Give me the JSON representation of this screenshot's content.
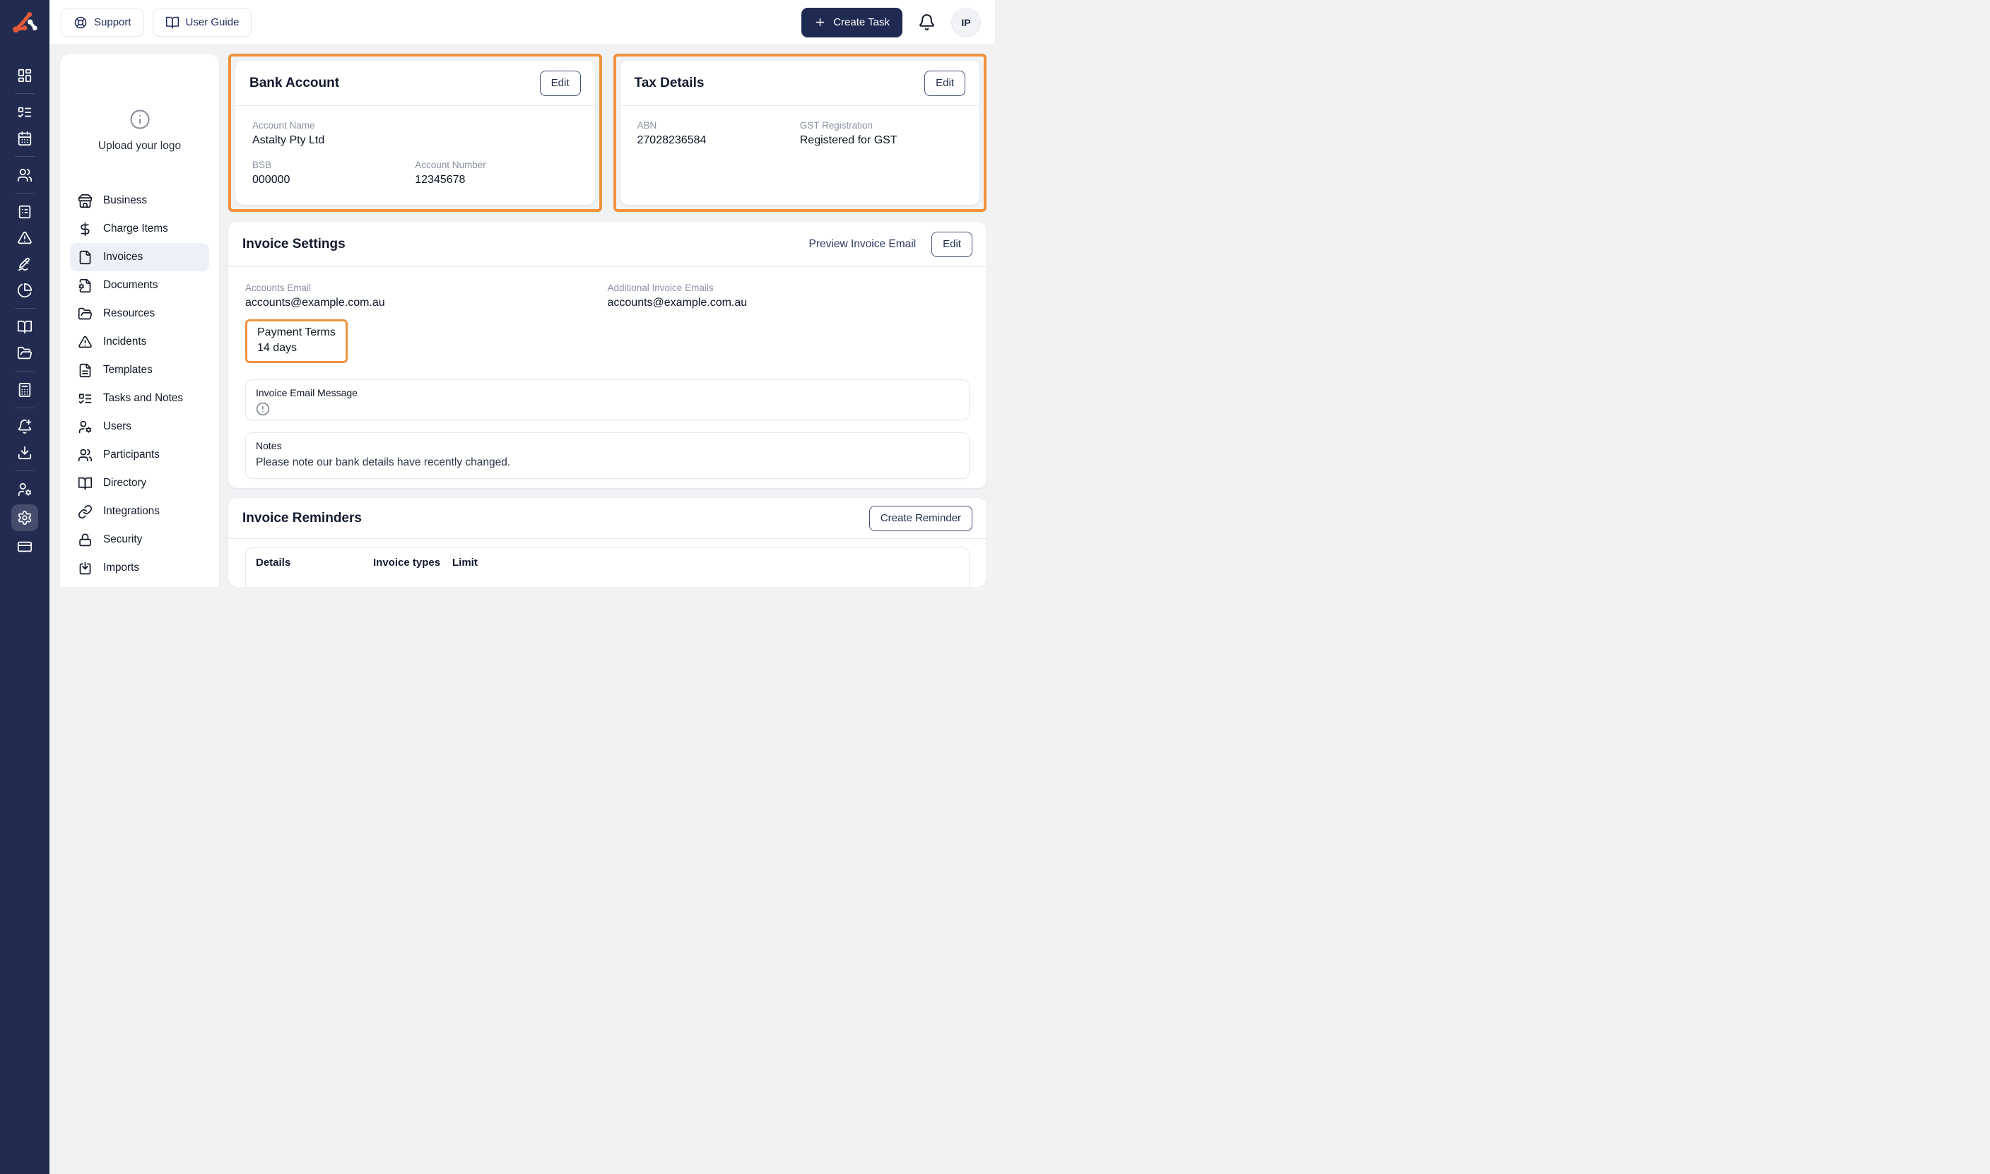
{
  "colors": {
    "accent_orange": "#F0923F",
    "navy": "#1E2A52",
    "rail_navy": "#212C50",
    "page_bg": "#F1F2F4"
  },
  "topbar": {
    "support": "Support",
    "user_guide": "User Guide",
    "create_task": "Create Task",
    "avatar_initials": "IP"
  },
  "rail": {
    "icons": [
      "dashboard",
      "list-checks",
      "calendar",
      "users",
      "file-list",
      "alert-triangle",
      "signature",
      "pie-chart",
      "book-open",
      "folder-open",
      "calculator",
      "bell-plus",
      "download",
      "user-cog",
      "settings",
      "credit-card"
    ],
    "active_icon": "settings"
  },
  "settings_nav": {
    "upload_logo": "Upload your logo",
    "items": [
      {
        "label": "Business",
        "icon": "store"
      },
      {
        "label": "Charge Items",
        "icon": "dollar-sign"
      },
      {
        "label": "Invoices",
        "icon": "file",
        "active": true
      },
      {
        "label": "Documents",
        "icon": "file-cog"
      },
      {
        "label": "Resources",
        "icon": "folder-open"
      },
      {
        "label": "Incidents",
        "icon": "alert-triangle"
      },
      {
        "label": "Templates",
        "icon": "file-text"
      },
      {
        "label": "Tasks and Notes",
        "icon": "list-checks"
      },
      {
        "label": "Users",
        "icon": "user-cog"
      },
      {
        "label": "Participants",
        "icon": "users"
      },
      {
        "label": "Directory",
        "icon": "book-open"
      },
      {
        "label": "Integrations",
        "icon": "link"
      },
      {
        "label": "Security",
        "icon": "lock"
      },
      {
        "label": "Imports",
        "icon": "import"
      }
    ]
  },
  "bank_account": {
    "title": "Bank Account",
    "edit": "Edit",
    "account_name_label": "Account Name",
    "account_name": "Astalty Pty Ltd",
    "bsb_label": "BSB",
    "bsb": "000000",
    "account_number_label": "Account Number",
    "account_number": "12345678",
    "highlighted": true
  },
  "tax_details": {
    "title": "Tax Details",
    "edit": "Edit",
    "abn_label": "ABN",
    "abn": "27028236584",
    "gst_label": "GST Registration",
    "gst": "Registered for GST",
    "highlighted": true
  },
  "invoice_settings": {
    "title": "Invoice Settings",
    "preview_link": "Preview Invoice Email",
    "edit": "Edit",
    "accounts_email_label": "Accounts Email",
    "accounts_email": "accounts@example.com.au",
    "additional_emails_label": "Additional Invoice Emails",
    "additional_emails": "accounts@example.com.au",
    "payment_terms_label": "Payment Terms",
    "payment_terms": "14 days",
    "payment_terms_highlighted": true,
    "email_message_label": "Invoice Email Message",
    "notes_label": "Notes",
    "notes": "Please note our bank details have recently changed."
  },
  "invoice_reminders": {
    "title": "Invoice Reminders",
    "create": "Create Reminder",
    "columns": [
      "Details",
      "Invoice types",
      "Limit"
    ]
  }
}
